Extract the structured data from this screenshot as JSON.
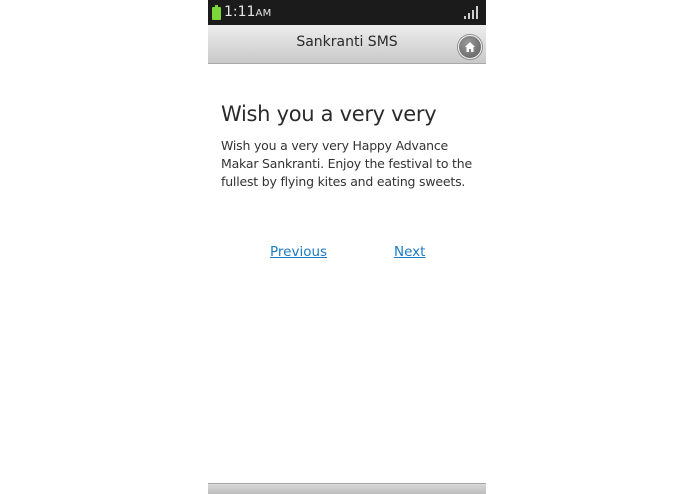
{
  "status_bar": {
    "time": "1:11",
    "ampm": "AM",
    "icons": [
      "battery-icon",
      "signal-icon"
    ]
  },
  "header": {
    "title": "Sankranti SMS",
    "home_icon": "home-icon"
  },
  "message": {
    "title": "Wish you a very very",
    "body": "Wish you a very very Happy Advance Makar Sankranti. Enjoy the festival to the fullest by flying kites and eating sweets."
  },
  "navigation": {
    "previous_label": "Previous",
    "next_label": "Next"
  },
  "colors": {
    "status_bar": "#1b1b1b",
    "link": "#1b7bc2",
    "battery": "#7cd63a"
  }
}
